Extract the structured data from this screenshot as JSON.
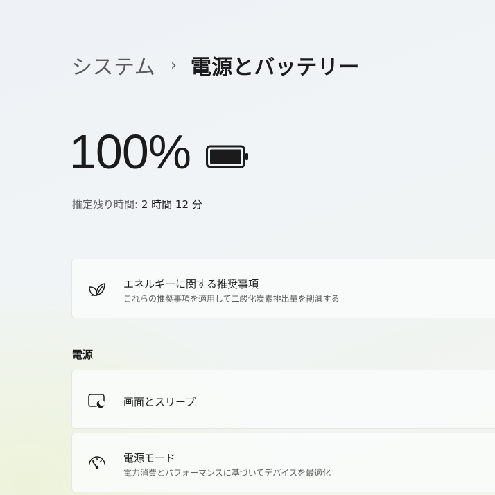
{
  "breadcrumb": {
    "parent": "システム",
    "separator": "›",
    "current": "電源とバッテリー"
  },
  "battery": {
    "percent_text": "100%",
    "level": 1.0,
    "estimate_label": "推定残り時間:",
    "estimate_value": "2 時間 12 分"
  },
  "recommendations_card": {
    "icon": "leaf-icon",
    "title": "エネルギーに関する推奨事項",
    "subtitle": "これらの推奨事項を適用して二酸化炭素排出量を削減する"
  },
  "power_section": {
    "heading": "電源",
    "items": [
      {
        "icon": "screen-sleep-icon",
        "title": "画面とスリープ"
      },
      {
        "icon": "power-mode-gauge-icon",
        "title": "電源モード",
        "subtitle": "電力消費とパフォーマンスに基づいてデバイスを最適化"
      }
    ]
  },
  "colors": {
    "text_primary": "#1b1b1b",
    "text_secondary": "#5f5f5f",
    "card_border": "#e4e6e8"
  }
}
